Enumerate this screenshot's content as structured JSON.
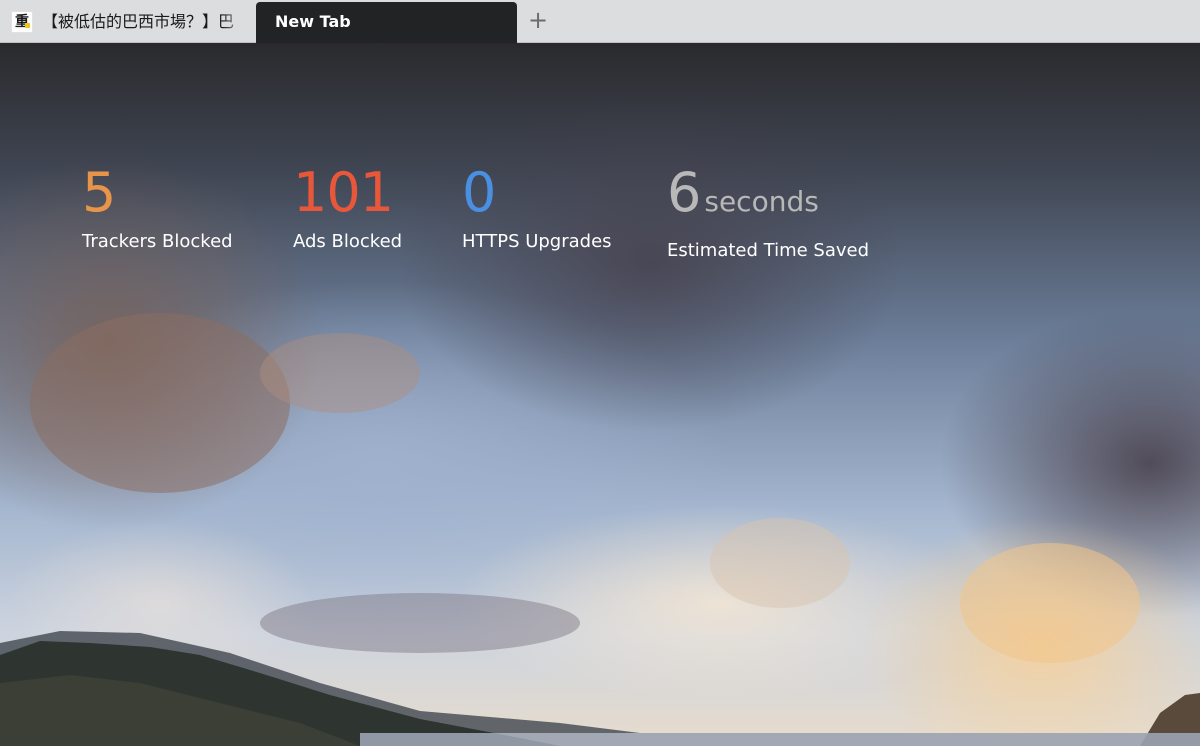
{
  "tabs": [
    {
      "title": "【被低估的巴西市場？】巴",
      "favicon": "重",
      "active": false
    },
    {
      "title": "New Tab",
      "active": true
    }
  ],
  "new_tab_symbol": "+",
  "stats": [
    {
      "value": "5",
      "label": "Trackers Blocked",
      "color": "#e8954a"
    },
    {
      "value": "101",
      "label": "Ads Blocked",
      "color": "#e9573a"
    },
    {
      "value": "0",
      "label": "HTTPS Upgrades",
      "color": "#4a90e2"
    },
    {
      "value": "6",
      "unit": "seconds",
      "label": "Estimated Time Saved",
      "color": "#b8b8b8"
    }
  ],
  "colors": {
    "tabstrip": "#dcdddf",
    "active_tab": "#222325"
  }
}
